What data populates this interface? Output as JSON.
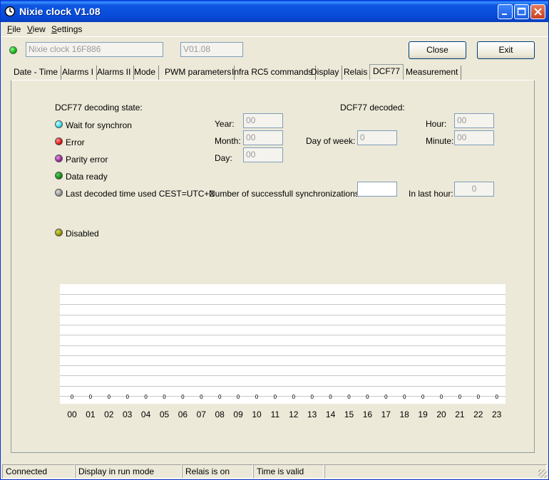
{
  "window": {
    "title": "Nixie clock V1.08"
  },
  "menu": [
    {
      "key": "F",
      "rest": "ile"
    },
    {
      "key": "V",
      "rest": "iew"
    },
    {
      "key": "S",
      "rest": "ettings"
    }
  ],
  "device": {
    "name": "Nixie clock 16F886",
    "version": "V01.08",
    "status_color": "#10b010"
  },
  "buttons": {
    "close": "Close",
    "exit": "Exit"
  },
  "tabs": [
    "Date - Time",
    "Alarms I",
    "Alarms II",
    "Mode",
    "PWM parameters",
    "Infra RC5 commands",
    "Display",
    "Relais",
    "DCF77",
    "Measurement"
  ],
  "active_tab": "DCF77",
  "dcf": {
    "state_title": "DCF77 decoding state:",
    "states": [
      {
        "label": "Wait for synchron",
        "color": "cyan"
      },
      {
        "label": "Error",
        "color": "red"
      },
      {
        "label": "Parity error",
        "color": "purple"
      },
      {
        "label": "Data ready",
        "color": "green"
      },
      {
        "label": "Last decoded time used CEST=UTC+2",
        "color": "gray"
      }
    ],
    "disabled": "Disabled",
    "decoded_title": "DCF77 decoded:",
    "year_label": "Year:",
    "year": "00",
    "month_label": "Month:",
    "month": "00",
    "day_label": "Day:",
    "day": "00",
    "dow_label": "Day of week:",
    "dow": "0",
    "hour_label": "Hour:",
    "hour": "00",
    "minute_label": "Minute:",
    "minute": "00",
    "sync_label": "Number of successfull synchronizations:",
    "sync": "",
    "last_hour_label": "In last hour:",
    "last_hour": "0"
  },
  "chart_data": {
    "type": "bar",
    "categories": [
      "00",
      "01",
      "02",
      "03",
      "04",
      "05",
      "06",
      "07",
      "08",
      "09",
      "10",
      "11",
      "12",
      "13",
      "14",
      "15",
      "16",
      "17",
      "18",
      "19",
      "20",
      "21",
      "22",
      "23"
    ],
    "values": [
      0,
      0,
      0,
      0,
      0,
      0,
      0,
      0,
      0,
      0,
      0,
      0,
      0,
      0,
      0,
      0,
      0,
      0,
      0,
      0,
      0,
      0,
      0,
      0
    ],
    "grid": true
  },
  "status": [
    "Connected",
    "Display in run mode",
    "Relais is on",
    "Time is valid",
    ""
  ]
}
